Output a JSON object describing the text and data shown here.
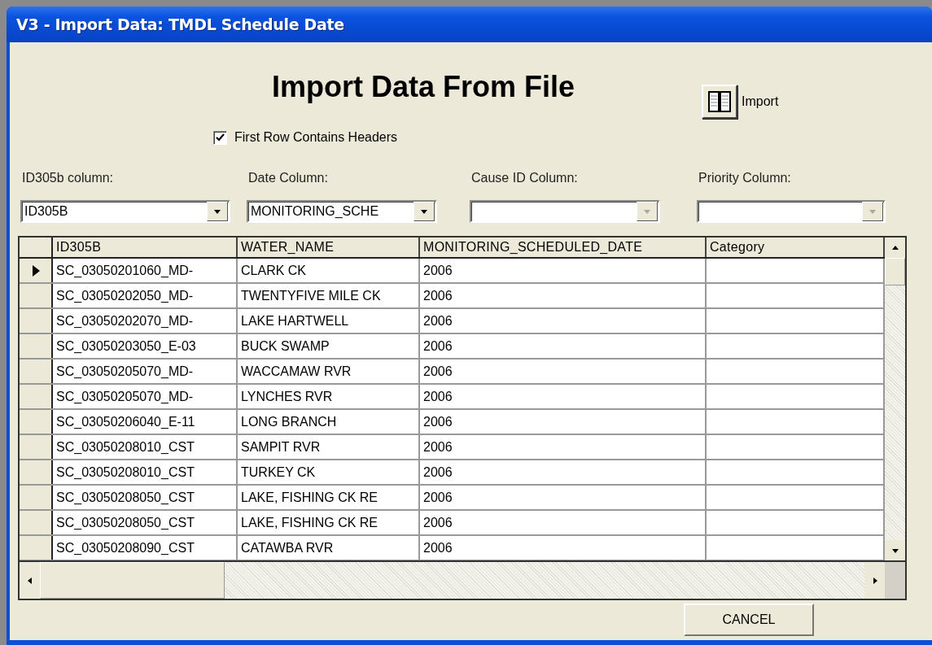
{
  "window": {
    "title": "V3 - Import Data: TMDL Schedule Date"
  },
  "heading": "Import Data From File",
  "import_button": {
    "label": "Import"
  },
  "first_row_headers": {
    "label": "First Row Contains Headers",
    "checked": true
  },
  "column_pickers": [
    {
      "label": "ID305b column:",
      "value": "ID305B",
      "disabled": false
    },
    {
      "label": "Date Column:",
      "value": "MONITORING_SCHE",
      "disabled": false
    },
    {
      "label": "Cause ID Column:",
      "disabled": true
    },
    {
      "label": "Priority Column:",
      "disabled": true
    }
  ],
  "table": {
    "columns": [
      "ID305B",
      "WATER_NAME",
      "MONITORING_SCHEDULED_DATE",
      "Category"
    ],
    "rows": [
      {
        "cells": [
          "SC_03050201060_MD-",
          "CLARK CK",
          "2006"
        ],
        "selected": true
      },
      {
        "cells": [
          "SC_03050202050_MD-",
          "TWENTYFIVE MILE CK",
          "2006"
        ],
        "selected": false
      },
      {
        "cells": [
          "SC_03050202070_MD-",
          "LAKE HARTWELL",
          "2006"
        ],
        "selected": false
      },
      {
        "cells": [
          "SC_03050203050_E-03",
          "BUCK SWAMP",
          "2006"
        ],
        "selected": false
      },
      {
        "cells": [
          "SC_03050205070_MD-",
          "WACCAMAW RVR",
          "2006"
        ],
        "selected": false
      },
      {
        "cells": [
          "SC_03050205070_MD-",
          "LYNCHES RVR",
          "2006"
        ],
        "selected": false
      },
      {
        "cells": [
          "SC_03050206040_E-11",
          "LONG BRANCH",
          "2006"
        ],
        "selected": false
      },
      {
        "cells": [
          "SC_03050208010_CST",
          "SAMPIT RVR",
          "2006"
        ],
        "selected": false
      },
      {
        "cells": [
          "SC_03050208010_CST",
          "TURKEY CK",
          "2006"
        ],
        "selected": false
      },
      {
        "cells": [
          "SC_03050208050_CST",
          "LAKE, FISHING CK RE",
          "2006"
        ],
        "selected": false
      },
      {
        "cells": [
          "SC_03050208050_CST",
          "LAKE, FISHING CK RE",
          "2006"
        ],
        "selected": false
      },
      {
        "cells": [
          "SC_03050208090_CST",
          "CATAWBA RVR",
          "2006"
        ],
        "selected": false
      }
    ]
  },
  "buttons": [
    "CANCEL"
  ]
}
